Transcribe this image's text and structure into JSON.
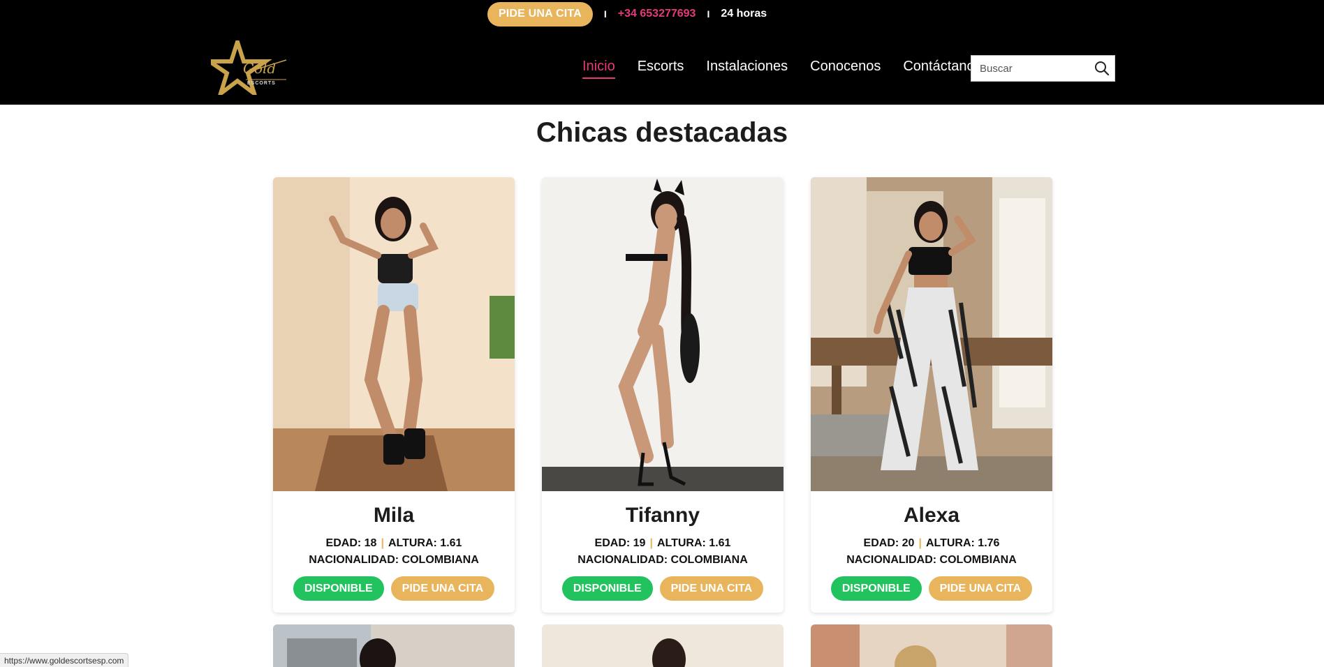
{
  "topbar": {
    "cta_label": "PIDE UNA CITA",
    "separator": "I",
    "phone": "+34 653277693",
    "hours": "24 horas"
  },
  "logo": {
    "script_text": "Gold",
    "small_text": "ESCORTS"
  },
  "nav": {
    "items": [
      "Inicio",
      "Escorts",
      "Instalaciones",
      "Conocenos",
      "Contáctanos"
    ],
    "active": "Inicio"
  },
  "search": {
    "placeholder": "Buscar",
    "value": "",
    "icon": "search-icon"
  },
  "main": {
    "title": "Chicas destacadas"
  },
  "cards": [
    {
      "name": "Mila",
      "edad": "EDAD: 18",
      "altura": "ALTURA: 1.61",
      "nacionalidad": "NACIONALIDAD: COLOMBIANA",
      "status": "DISPONIBLE",
      "cta": "PIDE UNA CITA"
    },
    {
      "name": "Tifanny",
      "edad": "EDAD: 19",
      "altura": "ALTURA: 1.61",
      "nacionalidad": "NACIONALIDAD: COLOMBIANA",
      "status": "DISPONIBLE",
      "cta": "PIDE UNA CITA"
    },
    {
      "name": "Alexa",
      "edad": "EDAD: 20",
      "altura": "ALTURA: 1.76",
      "nacionalidad": "NACIONALIDAD: COLOMBIANA",
      "status": "DISPONIBLE",
      "cta": "PIDE UNA CITA"
    }
  ],
  "statusbar": {
    "url": "https://www.goldescortsesp.com"
  },
  "colors": {
    "accent_pink": "#e6397a",
    "gold": "#e8b55d",
    "green": "#22c35e",
    "header_bg": "#000000"
  }
}
